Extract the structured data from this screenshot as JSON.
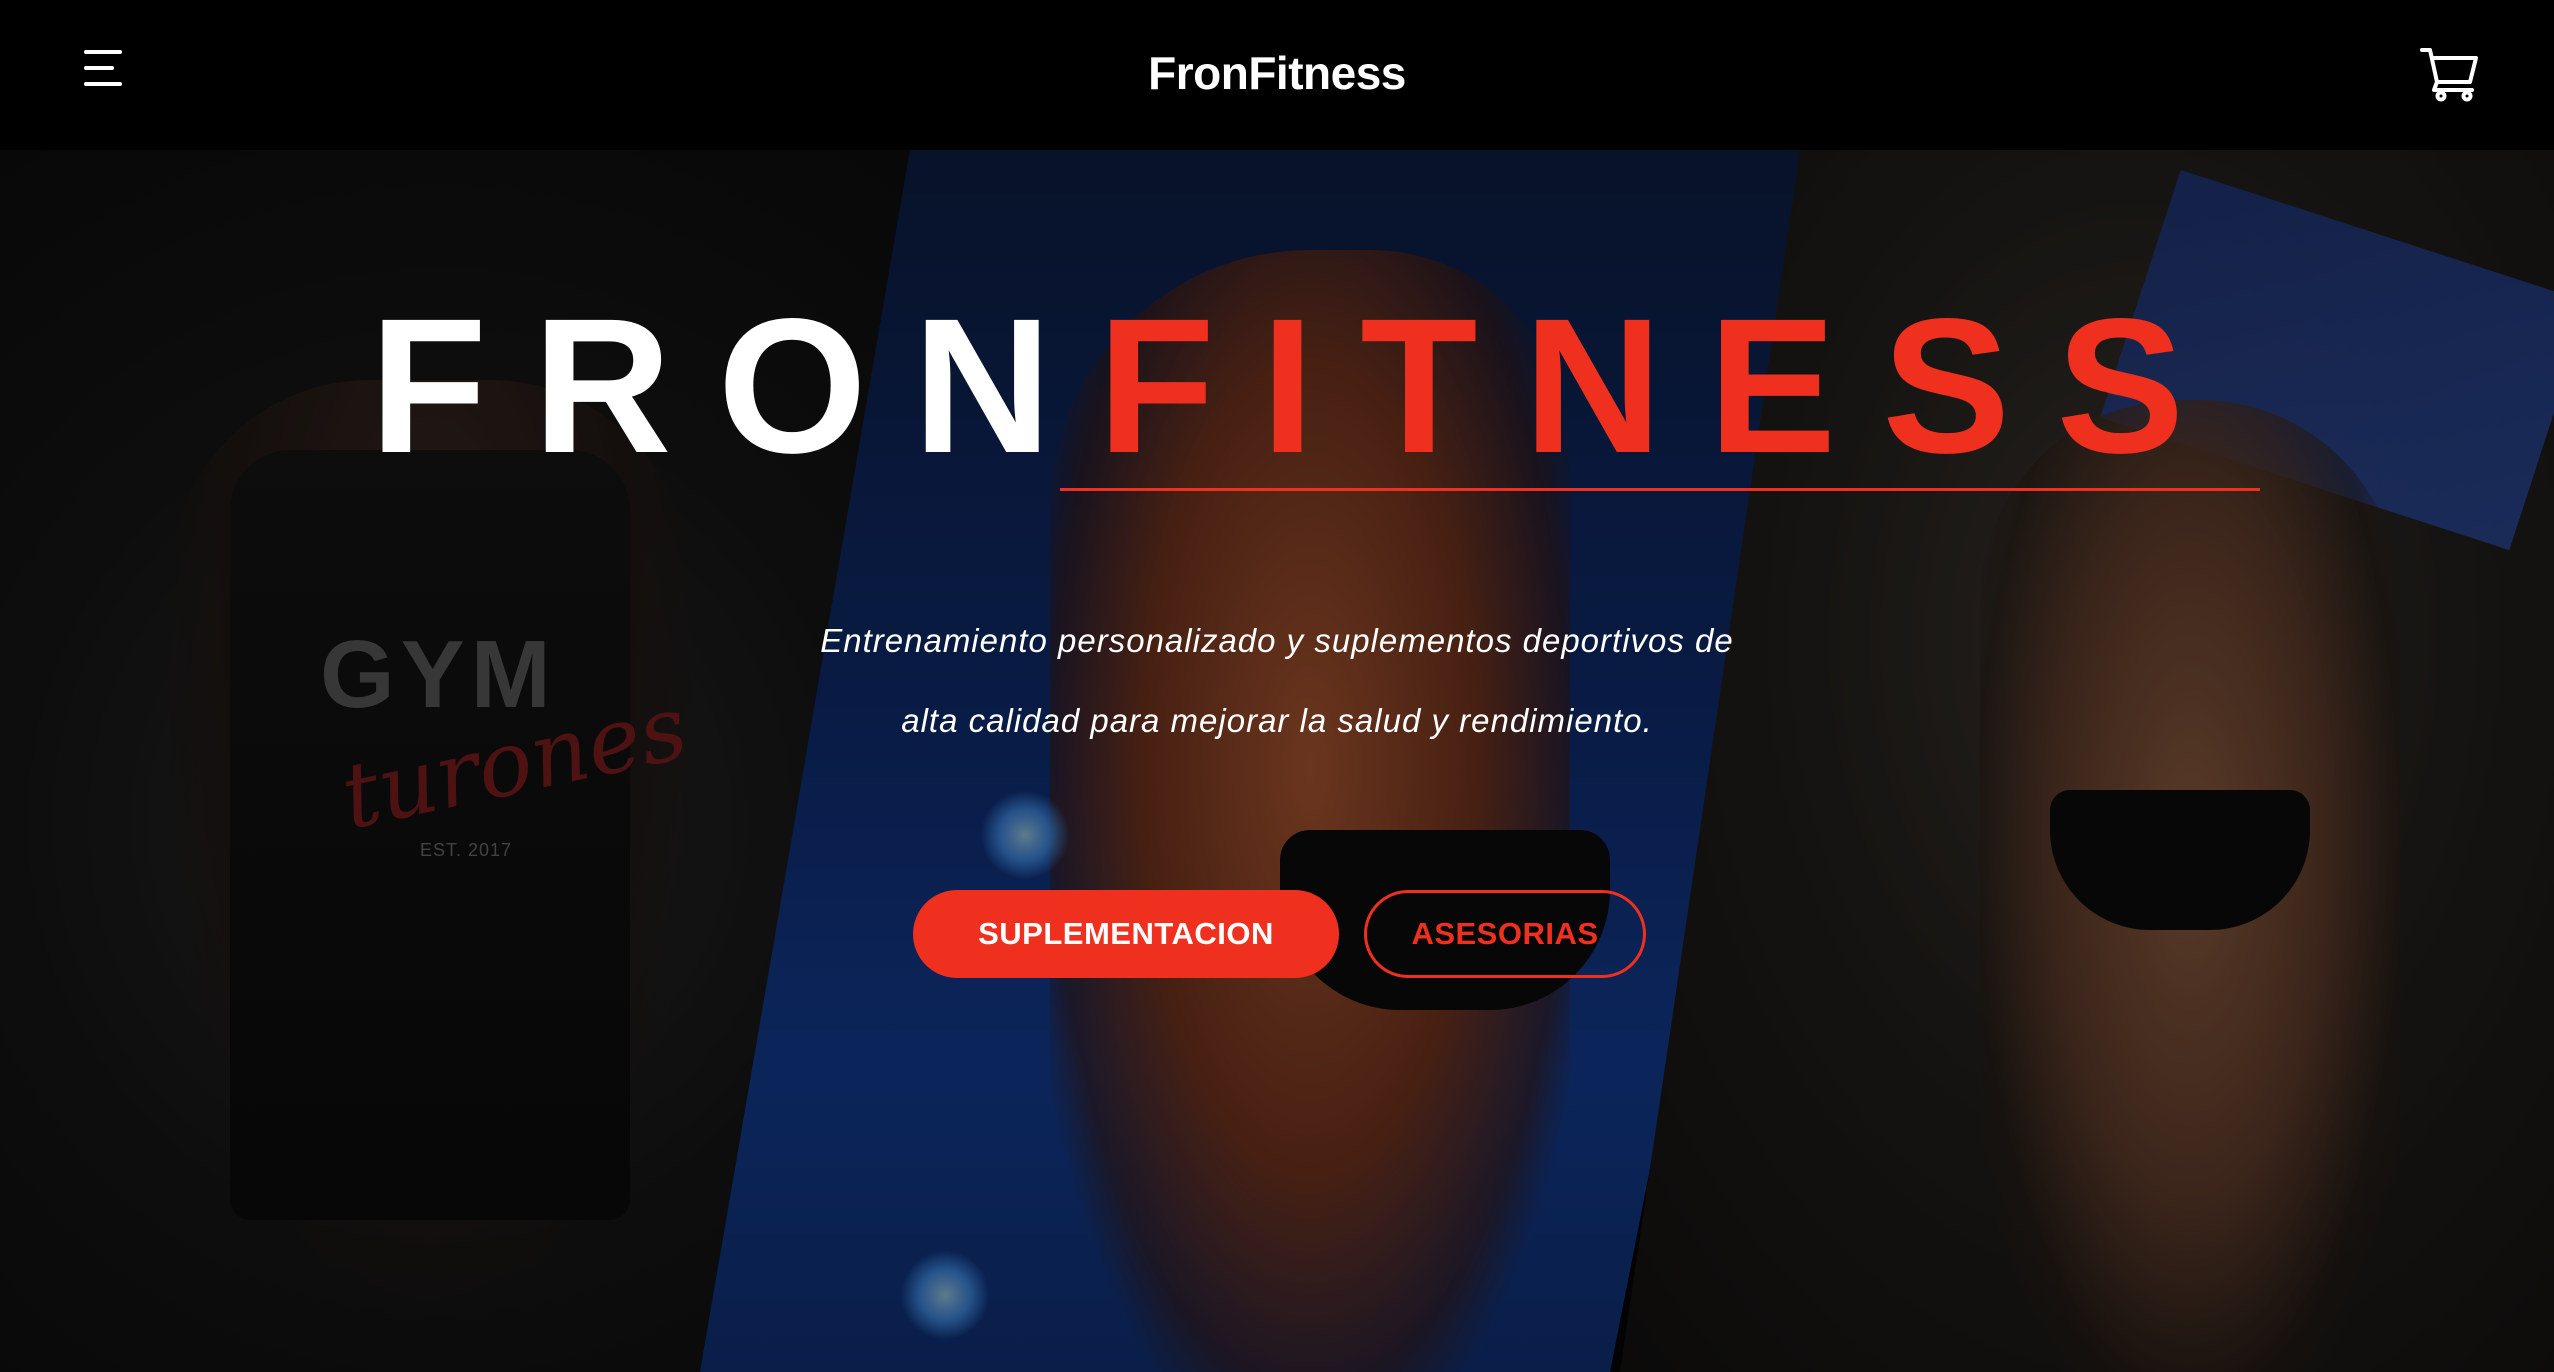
{
  "header": {
    "brand": "FronFitness",
    "menu_icon": "hamburger-menu-icon",
    "cart_icon": "shopping-cart-icon"
  },
  "hero": {
    "title_part1": "FRON",
    "title_part2": "FITNESS",
    "tagline_line1": "Entrenamiento personalizado y suplementos deportivos de",
    "tagline_line2": "alta calidad para mejorar la salud y rendimiento.",
    "primary_button": "SUPLEMENTACION",
    "secondary_button": "ASESORIAS",
    "photo_text": {
      "shirt_gym": "GYM",
      "shirt_script": "turones",
      "shirt_est": "EST. 2017"
    }
  },
  "colors": {
    "accent": "#f0301e",
    "background": "#000000",
    "text": "#ffffff"
  }
}
